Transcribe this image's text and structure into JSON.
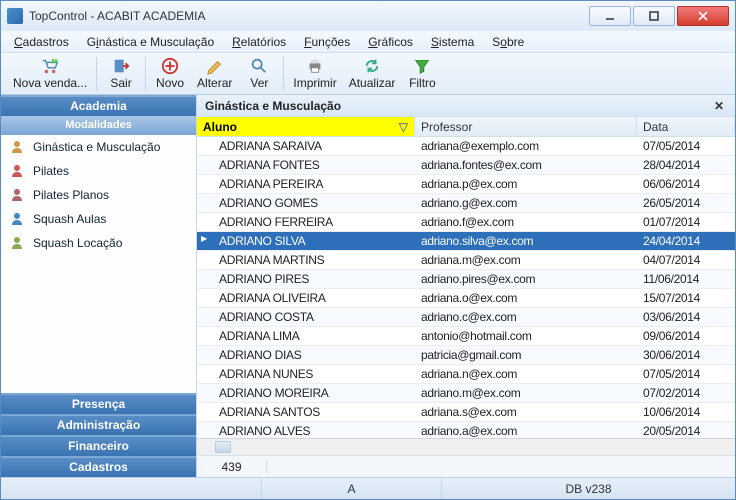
{
  "window": {
    "title": "TopControl - ACABIT ACADEMIA"
  },
  "menu": {
    "cadastros": "Cadastros",
    "ginastica": "Ginástica e Musculação",
    "relatorios": "Relatórios",
    "funcoes": "Funções",
    "graficos": "Gráficos",
    "sistema": "Sistema",
    "sobre": "Sobre"
  },
  "toolbar": {
    "nova_venda": "Nova venda...",
    "sair": "Sair",
    "novo": "Novo",
    "alterar": "Alterar",
    "ver": "Ver",
    "imprimir": "Imprimir",
    "atualizar": "Atualizar",
    "filtro": "Filtro"
  },
  "sidebar": {
    "academia": "Academia",
    "modalidades": "Modalidades",
    "items": [
      {
        "label": "Ginástica e Musculação"
      },
      {
        "label": "Pilates"
      },
      {
        "label": "Pilates Planos"
      },
      {
        "label": "Squash Aulas"
      },
      {
        "label": "Squash Locação"
      }
    ],
    "presenca": "Presença",
    "administracao": "Administração",
    "financeiro": "Financeiro",
    "cadastros": "Cadastros"
  },
  "grid": {
    "title": "Ginástica e Musculação",
    "col_aluno": "Aluno",
    "col_professor": "Professor",
    "col_data": "Data",
    "count": "439",
    "rows": [
      {
        "aluno": "ADRIANA SARAIVA",
        "professor": "adriana@exemplo.com",
        "data": "07/05/2014",
        "sel": false
      },
      {
        "aluno": "ADRIANA FONTES",
        "professor": "adriana.fontes@ex.com",
        "data": "28/04/2014",
        "sel": false
      },
      {
        "aluno": "ADRIANA PEREIRA",
        "professor": "adriana.p@ex.com",
        "data": "06/06/2014",
        "sel": false
      },
      {
        "aluno": "ADRIANO GOMES",
        "professor": "adriano.g@ex.com",
        "data": "26/05/2014",
        "sel": false
      },
      {
        "aluno": "ADRIANO FERREIRA",
        "professor": "adriano.f@ex.com",
        "data": "01/07/2014",
        "sel": false
      },
      {
        "aluno": "ADRIANO SILVA",
        "professor": "adriano.silva@ex.com",
        "data": "24/04/2014",
        "sel": true
      },
      {
        "aluno": "ADRIANA MARTINS",
        "professor": "adriana.m@ex.com",
        "data": "04/07/2014",
        "sel": false
      },
      {
        "aluno": "ADRIANO PIRES",
        "professor": "adriano.pires@ex.com",
        "data": "11/06/2014",
        "sel": false
      },
      {
        "aluno": "ADRIANA OLIVEIRA",
        "professor": "adriana.o@ex.com",
        "data": "15/07/2014",
        "sel": false
      },
      {
        "aluno": "ADRIANO COSTA",
        "professor": "adriano.c@ex.com",
        "data": "03/06/2014",
        "sel": false
      },
      {
        "aluno": "ADRIANA LIMA",
        "professor": "antonio@hotmail.com",
        "data": "09/06/2014",
        "sel": false
      },
      {
        "aluno": "ADRIANO DIAS",
        "professor": "patricia@gmail.com",
        "data": "30/06/2014",
        "sel": false
      },
      {
        "aluno": "ADRIANA NUNES",
        "professor": "adriana.n@ex.com",
        "data": "07/05/2014",
        "sel": false
      },
      {
        "aluno": "ADRIANO MOREIRA",
        "professor": "adriano.m@ex.com",
        "data": "07/02/2014",
        "sel": false
      },
      {
        "aluno": "ADRIANA SANTOS",
        "professor": "adriana.s@ex.com",
        "data": "10/06/2014",
        "sel": false
      },
      {
        "aluno": "ADRIANO ALVES",
        "professor": "adriano.a@ex.com",
        "data": "20/05/2014",
        "sel": false
      }
    ]
  },
  "status": {
    "user": "A",
    "db": "DB v238"
  }
}
